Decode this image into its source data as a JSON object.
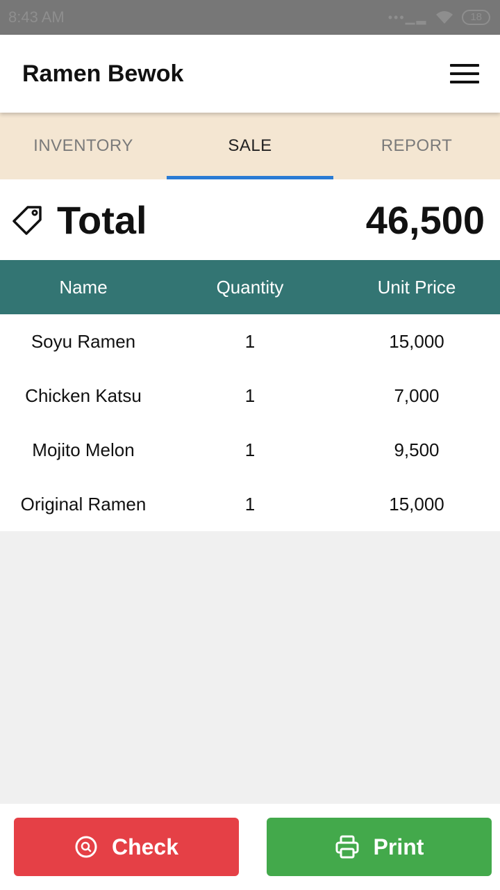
{
  "status_bar": {
    "time": "8:43 AM",
    "battery": "18"
  },
  "app_bar": {
    "title": "Ramen Bewok",
    "menu_icon": "hamburger-menu-icon"
  },
  "tabs": [
    {
      "label": "INVENTORY",
      "active": false
    },
    {
      "label": "SALE",
      "active": true
    },
    {
      "label": "REPORT",
      "active": false
    }
  ],
  "total": {
    "icon": "price-tag-icon",
    "label": "Total",
    "value": "46,500"
  },
  "table": {
    "columns": [
      "Name",
      "Quantity",
      "Unit Price"
    ],
    "rows": [
      {
        "name": "Soyu Ramen",
        "quantity": "1",
        "unit_price": "15,000"
      },
      {
        "name": "Chicken Katsu",
        "quantity": "1",
        "unit_price": "7,000"
      },
      {
        "name": "Mojito Melon",
        "quantity": "1",
        "unit_price": "9,500"
      },
      {
        "name": "Original Ramen",
        "quantity": "1",
        "unit_price": "15,000"
      }
    ]
  },
  "actions": {
    "check": {
      "label": "Check",
      "icon": "search-circle-icon",
      "color": "#e54046"
    },
    "print": {
      "label": "Print",
      "icon": "printer-icon",
      "color": "#43a94b"
    }
  },
  "colors": {
    "accent_tab": "#2a7bd4",
    "table_header": "#337573",
    "tab_bar": "#f4e6d2"
  }
}
